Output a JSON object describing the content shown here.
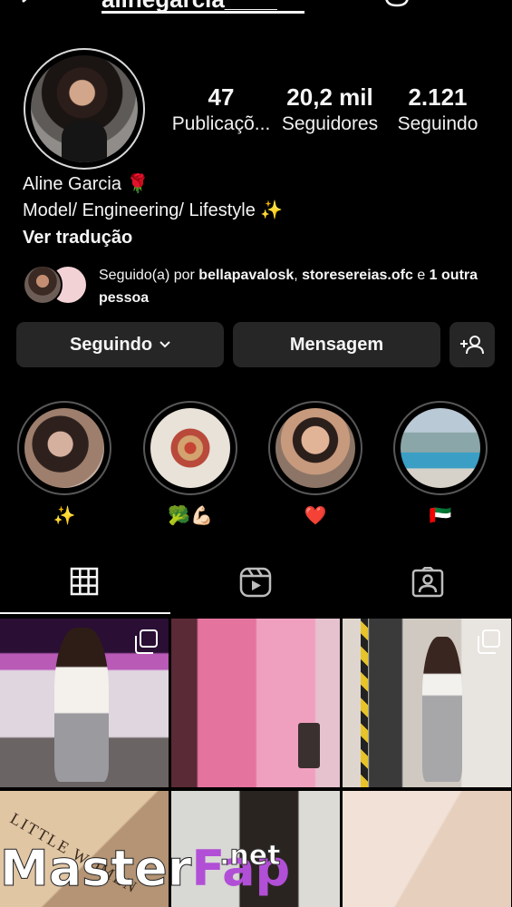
{
  "header": {
    "username": "alinegarcia____",
    "icons": [
      "back-arrow-icon",
      "bell-icon",
      "more-vertical-icon"
    ]
  },
  "profile": {
    "stats": [
      {
        "value": "47",
        "label": "Publicaçõ..."
      },
      {
        "value": "20,2 mil",
        "label": "Seguidores"
      },
      {
        "value": "2.121",
        "label": "Seguindo"
      }
    ],
    "name": "Aline Garcia 🌹",
    "bio": "Model/ Engineering/ Lifestyle ✨",
    "translate": "Ver tradução",
    "followed_by": {
      "prefix": "Seguido(a) por ",
      "user1": "bellapavalosk",
      "sep": ", ",
      "user2": "storesereias.ofc",
      "and": " e ",
      "others": "1 outra pessoa"
    }
  },
  "actions": {
    "following": "Seguindo",
    "message": "Mensagem"
  },
  "highlights": [
    {
      "caption": "✨"
    },
    {
      "caption": "🥦💪🏻"
    },
    {
      "caption": "❤️"
    },
    {
      "caption": "🇦🇪"
    }
  ],
  "tabs": [
    "grid-icon",
    "reels-icon",
    "tagged-icon"
  ],
  "book_text": "LITTLE WOMEN",
  "watermark": {
    "part1": "Master",
    "part2": "Fap",
    "part3": ".net"
  },
  "colors": {
    "background": "#000000",
    "button": "#262626",
    "text": "#f5f5f5",
    "watermark_accent": "#b14fd6"
  }
}
